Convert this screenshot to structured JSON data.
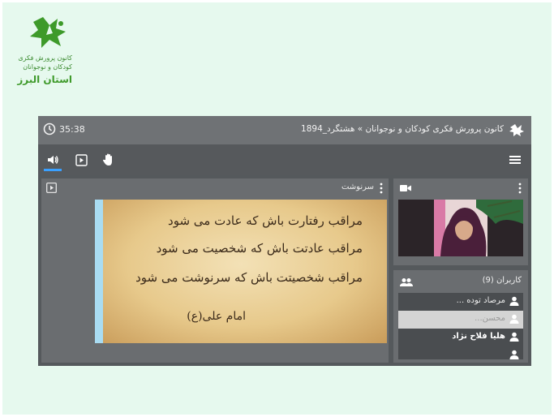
{
  "logo": {
    "line1": "کانون پرورش فکری",
    "line2": "کودکان و نوجوانان",
    "line3": "استان البرز",
    "color": "#3a8a2e"
  },
  "app": {
    "title": "کانون پرورش فکری کودکان و نوجوانان » هشتگرد_1894",
    "timer": "35:38",
    "accent": "#3aa0ff"
  },
  "toolbar": {
    "icons": [
      "speaker-icon",
      "screen-share-icon",
      "raise-hand-icon",
      "hamburger-menu-icon"
    ]
  },
  "presentation": {
    "title": "سرنوشت",
    "slide_lines": [
      "مراقب رفتارت باش که عادت می شود",
      "مراقب عادتت باش که شخصیت می شود",
      "مراقب شخصیتت باش که سرنوشت می شود",
      "امام علی(ع)"
    ]
  },
  "users": {
    "title": "کاربران (9)",
    "list": [
      {
        "name": "مرصاد توده ..."
      },
      {
        "name": "محسن..."
      },
      {
        "name": "هلیا فلاح نژاد"
      }
    ]
  }
}
